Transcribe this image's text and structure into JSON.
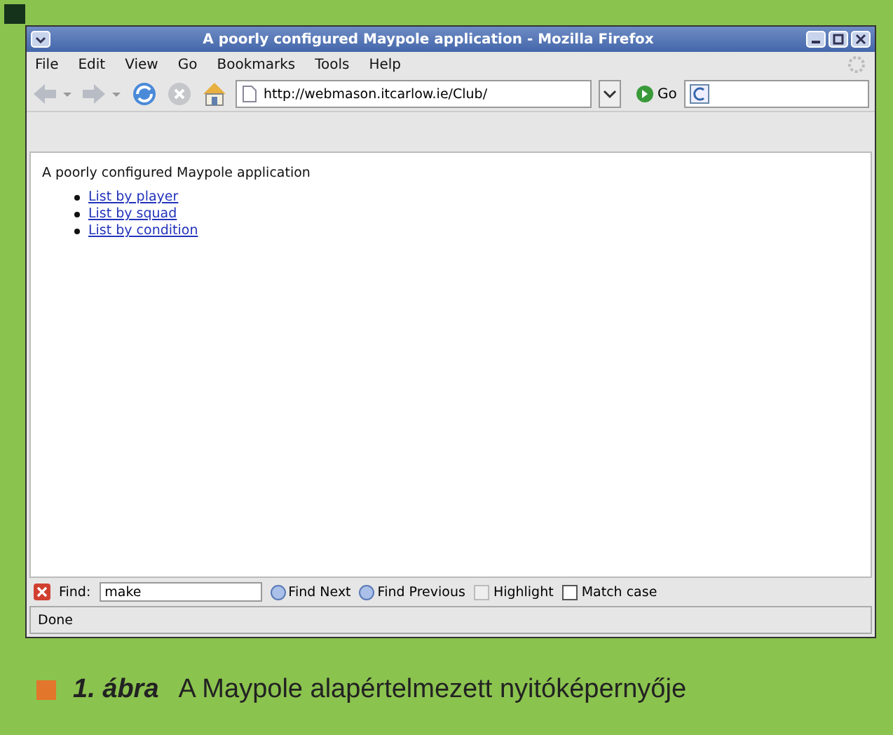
{
  "window": {
    "title": "A poorly configured Maypole application - Mozilla Firefox"
  },
  "menu": [
    "File",
    "Edit",
    "View",
    "Go",
    "Bookmarks",
    "Tools",
    "Help"
  ],
  "toolbar": {
    "address": "http://webmason.itcarlow.ie/Club/",
    "go_label": "Go"
  },
  "page": {
    "heading": "A poorly configured Maypole application",
    "links": [
      "List by player",
      "List by squad",
      "List by condition"
    ]
  },
  "find_bar": {
    "label": "Find:",
    "value": "make",
    "buttons": [
      "Find Next",
      "Find Previous"
    ],
    "checkboxes": [
      {
        "label": "Highlight",
        "checked": false,
        "disabled": true
      },
      {
        "label": "Match case",
        "checked": false,
        "disabled": false
      }
    ]
  },
  "status_bar": "Done",
  "caption": {
    "number": "1. ábra",
    "text": "A Maypole alapértelmezett nyitóképernyője"
  }
}
